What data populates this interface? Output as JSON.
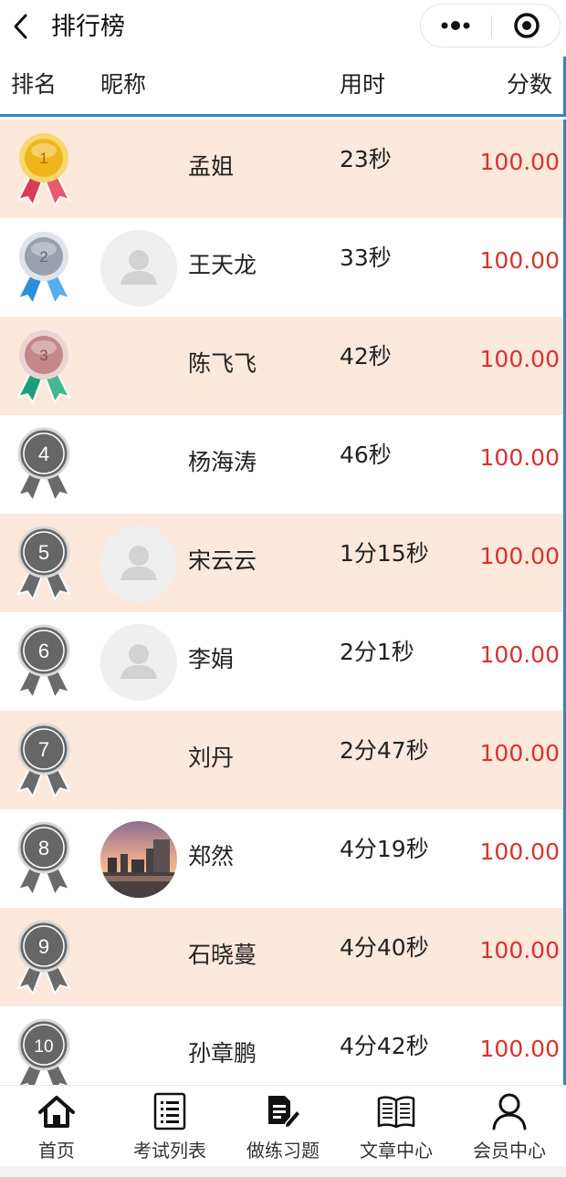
{
  "nav": {
    "title": "排行榜",
    "back_icon": "chevron-left-icon",
    "more_icon": "more-dots-icon",
    "close_icon": "target-close-icon"
  },
  "columns": {
    "rank": "排名",
    "nickname": "昵称",
    "time": "用时",
    "score": "分数"
  },
  "colors": {
    "accent": "#2f86c6",
    "score": "#d9322f",
    "odd_row": "#fde8dc",
    "gold": "#f1b51c",
    "silver": "#9aa0ad",
    "bronze": "#c4878a",
    "gray_medal": "#666666"
  },
  "rows": [
    {
      "rank": "1",
      "medal": "gold",
      "avatar": "none",
      "name": "孟姐",
      "time": "23秒",
      "score": "100.00"
    },
    {
      "rank": "2",
      "medal": "silver",
      "avatar": "default",
      "name": "王天龙",
      "time": "33秒",
      "score": "100.00"
    },
    {
      "rank": "3",
      "medal": "bronze",
      "avatar": "none",
      "name": "陈飞飞",
      "time": "42秒",
      "score": "100.00"
    },
    {
      "rank": "4",
      "medal": "gray",
      "avatar": "none",
      "name": "杨海涛",
      "time": "46秒",
      "score": "100.00"
    },
    {
      "rank": "5",
      "medal": "gray",
      "avatar": "default",
      "name": "宋云云",
      "time": "1分15秒",
      "score": "100.00"
    },
    {
      "rank": "6",
      "medal": "gray",
      "avatar": "default",
      "name": "李娟",
      "time": "2分1秒",
      "score": "100.00"
    },
    {
      "rank": "7",
      "medal": "gray",
      "avatar": "none",
      "name": "刘丹",
      "time": "2分47秒",
      "score": "100.00"
    },
    {
      "rank": "8",
      "medal": "gray",
      "avatar": "photo",
      "name": "郑然",
      "time": "4分19秒",
      "score": "100.00"
    },
    {
      "rank": "9",
      "medal": "gray",
      "avatar": "none",
      "name": "石晓蔓",
      "time": "4分40秒",
      "score": "100.00"
    },
    {
      "rank": "10",
      "medal": "gray",
      "avatar": "none",
      "name": "孙章鹏",
      "time": "4分42秒",
      "score": "100.00"
    }
  ],
  "tabs": [
    {
      "label": "首页",
      "icon": "home-icon"
    },
    {
      "label": "考试列表",
      "icon": "list-icon"
    },
    {
      "label": "做练习题",
      "icon": "edit-document-icon"
    },
    {
      "label": "文章中心",
      "icon": "book-icon"
    },
    {
      "label": "会员中心",
      "icon": "user-icon"
    }
  ]
}
